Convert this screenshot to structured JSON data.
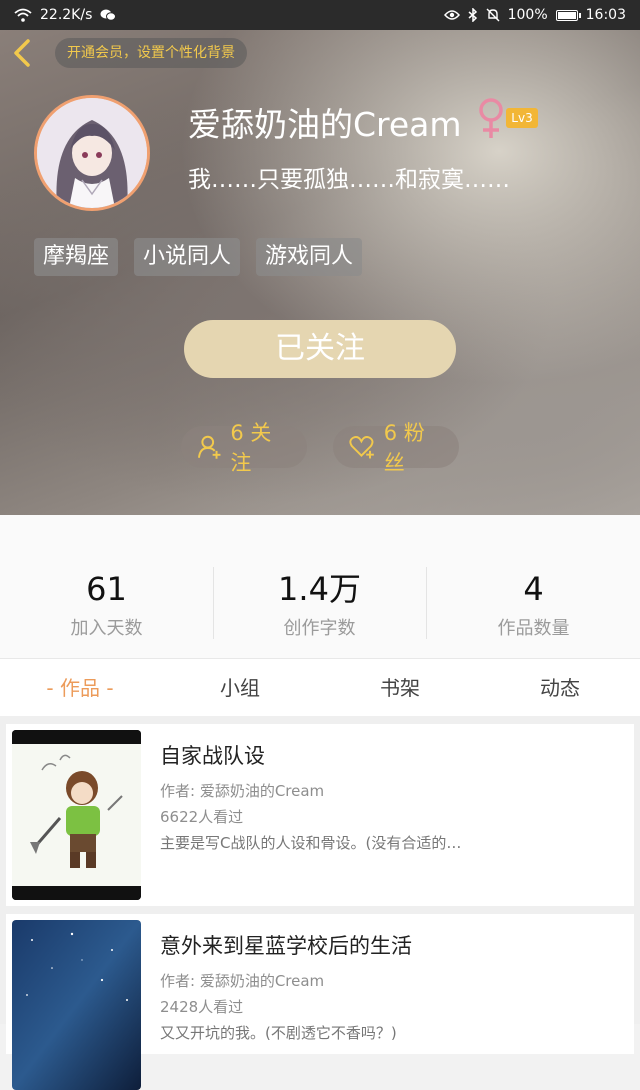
{
  "status_bar": {
    "net_speed": "22.2K/s",
    "battery": "100%",
    "time": "16:03"
  },
  "header": {
    "vip_prompt": "开通会员，设置个性化背景",
    "username": "爱舔奶油的Cream",
    "level": "Lv3",
    "signature": "我……只要孤独……和寂寞……",
    "tags": [
      "摩羯座",
      "小说同人",
      "游戏同人"
    ],
    "follow_button": "已关注",
    "following_count": "6 关注",
    "fans_count": "6 粉丝"
  },
  "stats": [
    {
      "value": "61",
      "label": "加入天数"
    },
    {
      "value": "1.4万",
      "label": "创作字数"
    },
    {
      "value": "4",
      "label": "作品数量"
    }
  ],
  "tabs": [
    "- 作品 -",
    "小组",
    "书架",
    "动态"
  ],
  "works": [
    {
      "title": "自家战队设",
      "author": "作者: 爱舔奶油的Cream",
      "views": "6622人看过",
      "desc": "主要是写C战队的人设和骨设。(没有合适的…"
    },
    {
      "title": "意外来到星蓝学校后的生活",
      "author": "作者: 爱舔奶油的Cream",
      "views": "2428人看过",
      "desc": "又又开坑的我。(不剧透它不香吗？)"
    }
  ],
  "colors": {
    "accent": "#ec9b5a",
    "gold": "#f2c94c",
    "follow_button": "#e5d6b1",
    "gender_pink": "#e98aa4"
  }
}
